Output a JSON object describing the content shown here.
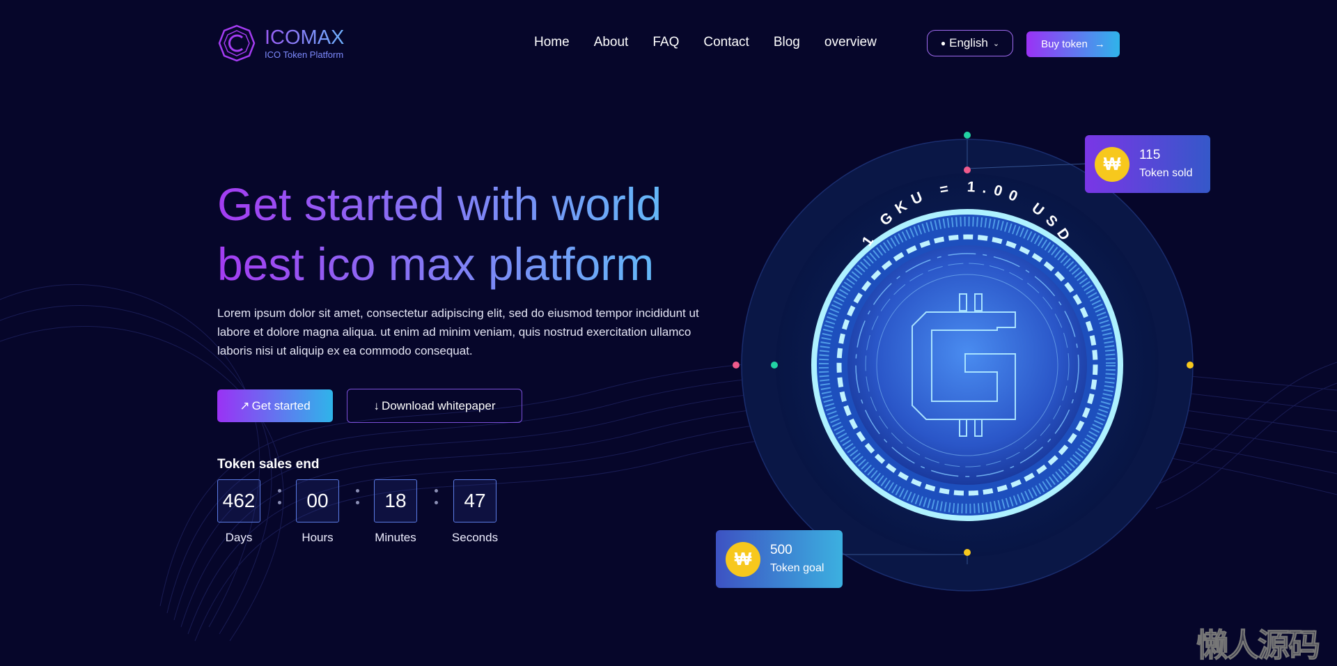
{
  "brand": {
    "name": "ICOMAX",
    "tagline": "ICO Token Platform"
  },
  "nav": {
    "items": [
      "Home",
      "About",
      "FAQ",
      "Contact",
      "Blog",
      "overview"
    ]
  },
  "header": {
    "language": "English",
    "buy_label": "Buy token"
  },
  "hero": {
    "headline_line1": "Get started with world",
    "headline_line2": "best ico max platform",
    "description": "Lorem ipsum dolor sit amet, consectetur adipiscing elit, sed do eiusmod tempor incididunt ut labore et dolore magna aliqua. ut enim ad minim veniam, quis nostrud exercitation ullamco laboris nisi ut aliquip ex ea commodo consequat.",
    "primary_cta": "Get started",
    "secondary_cta": "Download whitepaper"
  },
  "countdown": {
    "title": "Token sales end",
    "units": [
      {
        "value": "462",
        "label": "Days"
      },
      {
        "value": "00",
        "label": "Hours"
      },
      {
        "value": "18",
        "label": "Minutes"
      },
      {
        "value": "47",
        "label": "Seconds"
      }
    ]
  },
  "coin": {
    "rate_text": "1 GKU = 1.00 USD",
    "symbol": "₩"
  },
  "stats": {
    "sold": {
      "value": "115",
      "label": "Token sold"
    },
    "goal": {
      "value": "500",
      "label": "Token goal"
    }
  },
  "colors": {
    "background": "#06062a",
    "accent_purple": "#9a32f5",
    "accent_blue": "#2fb4ea",
    "coin_gold": "#f7c81d"
  },
  "watermark": "懒人源码"
}
